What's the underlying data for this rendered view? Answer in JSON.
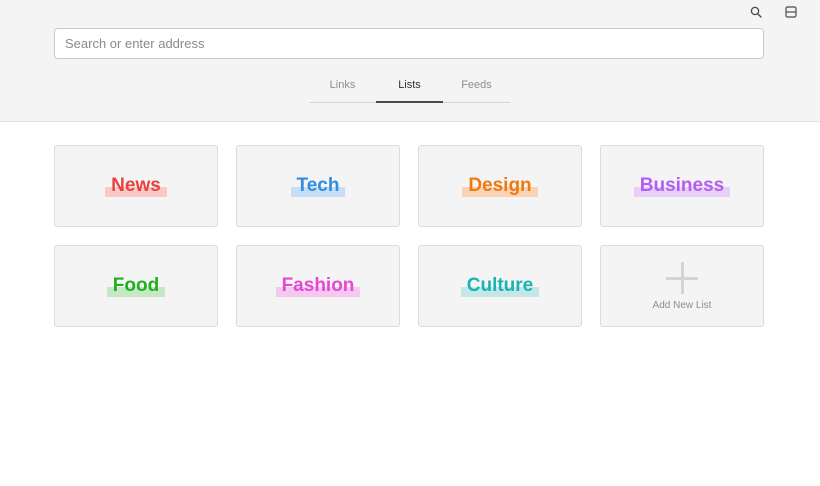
{
  "toolbar": {
    "search_icon": "search-icon",
    "sidebar_icon": "sidebar-toggle-icon"
  },
  "address_bar": {
    "placeholder": "Search or enter address",
    "value": ""
  },
  "tabs": [
    {
      "label": "Links",
      "active": false
    },
    {
      "label": "Lists",
      "active": true
    },
    {
      "label": "Feeds",
      "active": false
    }
  ],
  "lists": [
    {
      "label": "News",
      "color": "#e8413e",
      "highlight": "#f7c9c9"
    },
    {
      "label": "Tech",
      "color": "#2f8ee0",
      "highlight": "#c8ddf6"
    },
    {
      "label": "Design",
      "color": "#ee7a12",
      "highlight": "#f8d3b5"
    },
    {
      "label": "Business",
      "color": "#b25ef0",
      "highlight": "#e6cff8"
    },
    {
      "label": "Food",
      "color": "#1fb01f",
      "highlight": "#c6e8c6"
    },
    {
      "label": "Fashion",
      "color": "#e448d4",
      "highlight": "#f5c8ef"
    },
    {
      "label": "Culture",
      "color": "#18b3b3",
      "highlight": "#c5e7e7"
    }
  ],
  "add_list": {
    "label": "Add New List",
    "icon": "plus-icon"
  }
}
